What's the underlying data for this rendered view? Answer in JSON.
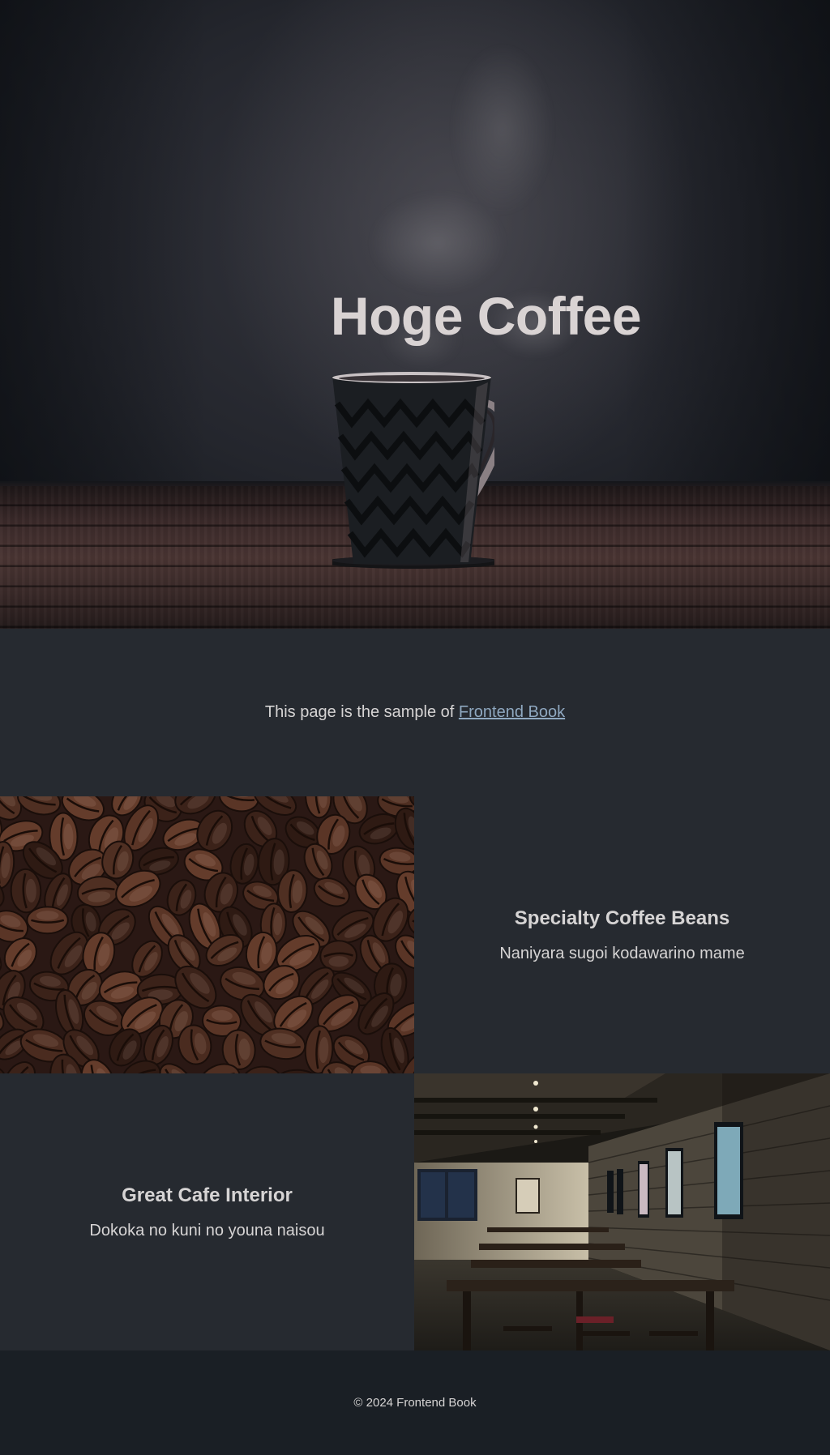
{
  "hero": {
    "title": "Hoge Coffee",
    "image": "steaming-coffee-mug-on-wooden-table"
  },
  "intro": {
    "text": "This page is the sample of ",
    "link_label": "Frontend Book"
  },
  "features": [
    {
      "title": "Specialty Coffee Beans",
      "description": "Naniyara sugoi kodawarino mame",
      "image": "roasted-coffee-beans"
    },
    {
      "title": "Great Cafe Interior",
      "description": "Dokoka no kuni no youna naisou",
      "image": "cafe-interior-tables"
    }
  ],
  "footer": {
    "copyright": "© 2024 Frontend Book"
  },
  "colors": {
    "background": "#262a30",
    "footer_background": "#1a1f25",
    "text": "#d6d4d4",
    "link": "#8fa8c0"
  }
}
